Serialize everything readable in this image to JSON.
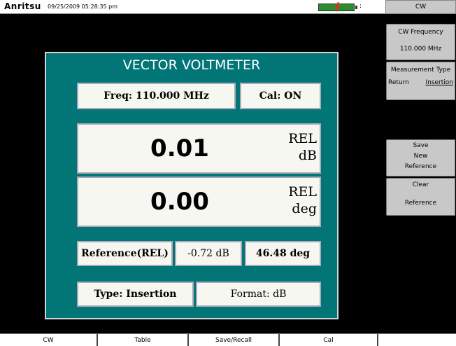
{
  "status": {
    "brand": "Anritsu",
    "datetime": "09/25/2009 05:28:35 pm",
    "battery_indicator": ":"
  },
  "panel": {
    "title": "VECTOR VOLTMETER",
    "freq": "Freq: 110.000 MHz",
    "cal": "Cal: ON",
    "readout1": {
      "value": "0.01",
      "unit_top": "REL",
      "unit_bottom": "dB"
    },
    "readout2": {
      "value": "0.00",
      "unit_top": "REL",
      "unit_bottom": "deg"
    },
    "reference_label": "Reference(REL)",
    "reference_db": "-0.72 dB",
    "reference_deg": "46.48 deg",
    "type": "Type: Insertion",
    "format": "Format: dB"
  },
  "menu": {
    "title": "CW",
    "cw_frequency": {
      "label": "CW Frequency",
      "value": "110.000 MHz"
    },
    "measurement_type": {
      "label": "Measurement Type",
      "option_a": "Return",
      "option_b": "Insertion"
    },
    "save_new_reference": {
      "line1": "Save",
      "line2": "New",
      "line3": "Reference"
    },
    "clear_reference": {
      "line1": "Clear",
      "line2": "Reference"
    }
  },
  "bottom_tabs": [
    "CW",
    "Table",
    "Save/Recall",
    "Cal",
    ""
  ],
  "colors": {
    "panel_bg": "#027577",
    "softkey_bg": "#c8c8c8",
    "battery": "#2e8b2e"
  }
}
